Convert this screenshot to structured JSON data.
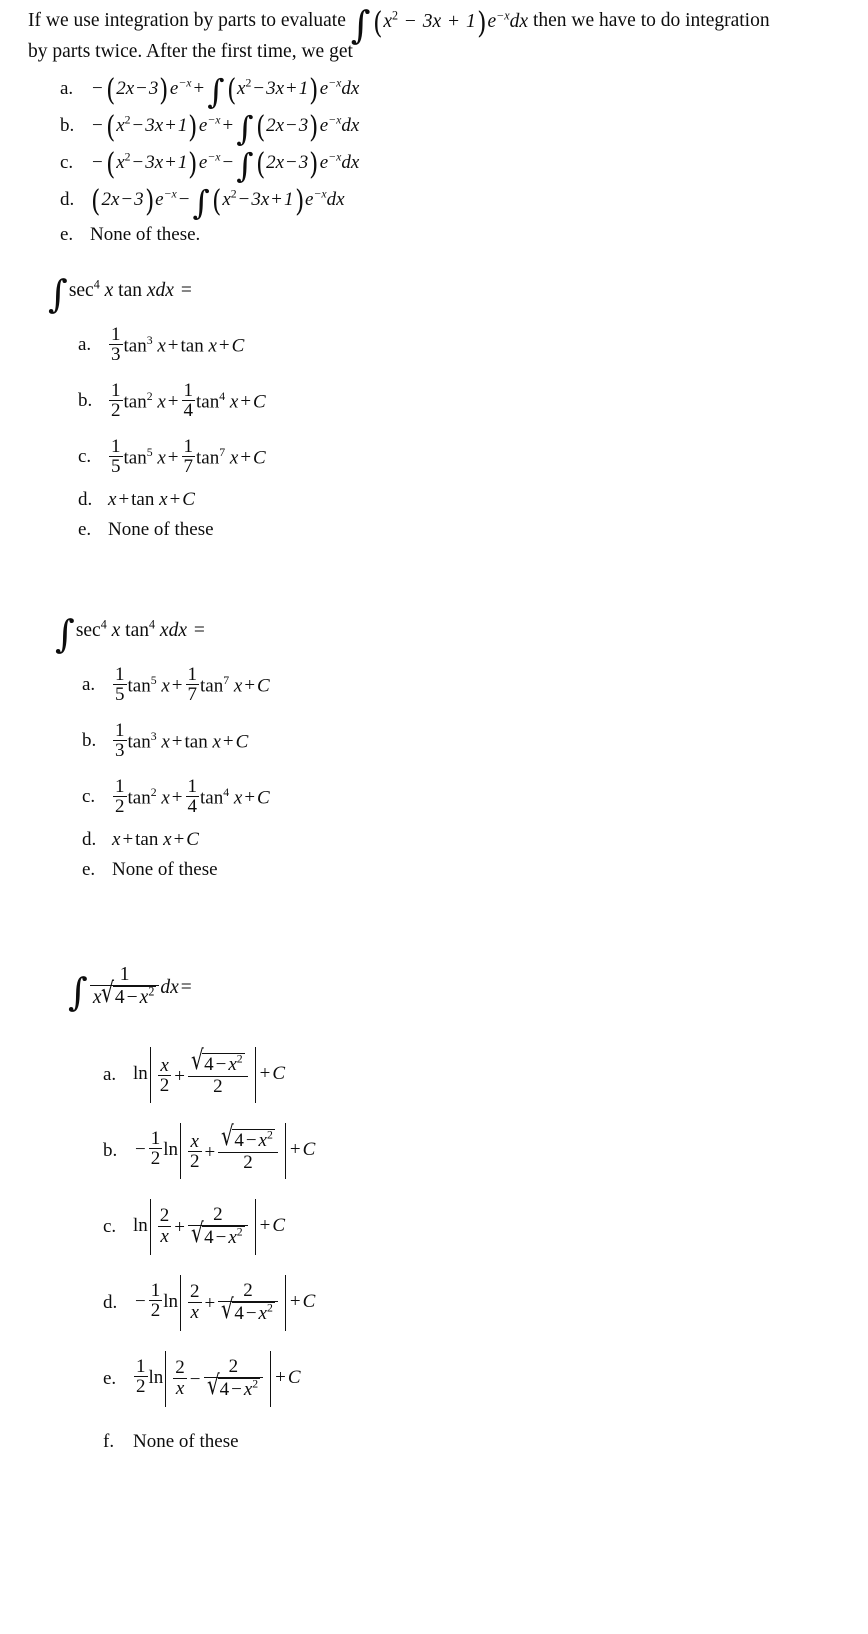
{
  "document": {
    "type": "calculus multiple choice worksheet",
    "background_color": "#ffffff",
    "text_color": "#0d0d0d"
  },
  "questions": [
    {
      "id": "q1",
      "stem_line1_pre": "If we use integration by parts to evaluate",
      "stem_line1_post": "then we have to do integration",
      "stem_line2": "by parts twice. After the first time, we get",
      "stem_integrand": {
        "polynomial": "x² − 3x + 1",
        "exponential": "e⁻x",
        "differential": "dx"
      },
      "options": [
        {
          "letter": "a.",
          "text": "−(2x−3)e⁻x + ∫(x²−3x+1)e⁻xdx"
        },
        {
          "letter": "b.",
          "text": "−(x²−3x+1)e⁻x + ∫(2x−3)e⁻xdx"
        },
        {
          "letter": "c.",
          "text": "−(x²−3x+1)e⁻x − ∫(2x−3)e⁻xdx"
        },
        {
          "letter": "d.",
          "text": "(2x−3)e⁻x − ∫(x²−3x+1)e⁻xdx"
        },
        {
          "letter": "e.",
          "text": "None of these."
        }
      ]
    },
    {
      "id": "q2",
      "stem": "∫ sec⁴ x tan x dx =",
      "stem_parts": {
        "sec_power": "4",
        "tan_power": "",
        "differential": "dx",
        "equals": "="
      },
      "options": [
        {
          "letter": "a.",
          "text": "(1/3)tan³ x + tan x + C",
          "frac1_num": "1",
          "frac1_den": "3",
          "pow1": "3",
          "pow2": ""
        },
        {
          "letter": "b.",
          "text": "(1/2)tan² x + (1/4)tan⁴ x + C",
          "frac1_num": "1",
          "frac1_den": "2",
          "pow1": "2",
          "frac2_num": "1",
          "frac2_den": "4",
          "pow2": "4"
        },
        {
          "letter": "c.",
          "text": "(1/5)tan⁵ x + (1/7)tan⁷ x + C",
          "frac1_num": "1",
          "frac1_den": "5",
          "pow1": "5",
          "frac2_num": "1",
          "frac2_den": "7",
          "pow2": "7"
        },
        {
          "letter": "d.",
          "text": "x + tan x + C"
        },
        {
          "letter": "e.",
          "text": "None of these"
        }
      ]
    },
    {
      "id": "q3",
      "stem": "∫ sec⁴ x tan⁴ x dx =",
      "stem_parts": {
        "sec_power": "4",
        "tan_power": "4",
        "differential": "dx",
        "equals": "="
      },
      "options": [
        {
          "letter": "a.",
          "text": "(1/5)tan⁵ x + (1/7)tan⁷ x + C",
          "frac1_num": "1",
          "frac1_den": "5",
          "pow1": "5",
          "frac2_num": "1",
          "frac2_den": "7",
          "pow2": "7"
        },
        {
          "letter": "b.",
          "text": "(1/3)tan³ x + tan x + C",
          "frac1_num": "1",
          "frac1_den": "3",
          "pow1": "3"
        },
        {
          "letter": "c.",
          "text": "(1/2)tan² x + (1/4)tan⁴ x + C",
          "frac1_num": "1",
          "frac1_den": "2",
          "pow1": "2",
          "frac2_num": "1",
          "frac2_den": "4",
          "pow2": "4"
        },
        {
          "letter": "d.",
          "text": "x + tan x + C"
        },
        {
          "letter": "e.",
          "text": "None of these"
        }
      ]
    },
    {
      "id": "q4",
      "stem": "∫ 1/(x√(4−x²)) dx =",
      "stem_parts": {
        "numerator": "1",
        "denominator_var": "x",
        "radicand": "4 − x²",
        "differential": "dx",
        "equals": "="
      },
      "options": [
        {
          "letter": "a.",
          "text": "ln|x/2 + √(4−x²)/2| + C"
        },
        {
          "letter": "b.",
          "text": "−(1/2)ln|x/2 + √(4−x²)/2| + C"
        },
        {
          "letter": "c.",
          "text": "ln|2/x + 2/√(4−x²)| + C"
        },
        {
          "letter": "d.",
          "text": "−(1/2)ln|2/x + 2/√(4−x²)| + C"
        },
        {
          "letter": "e.",
          "text": "(1/2)ln|2/x − 2/√(4−x²)| + C"
        },
        {
          "letter": "f.",
          "text": "None of these"
        }
      ]
    }
  ],
  "symbols": {
    "integral": "∫",
    "radical": "√",
    "minus": "−",
    "plus": "+",
    "equals": "=",
    "constant": "C",
    "ln": "ln",
    "sec": "sec",
    "tan": "tan",
    "dx": "dx",
    "e": "e",
    "paren_open": "(",
    "paren_close": ")",
    "abs_bar": "|"
  }
}
